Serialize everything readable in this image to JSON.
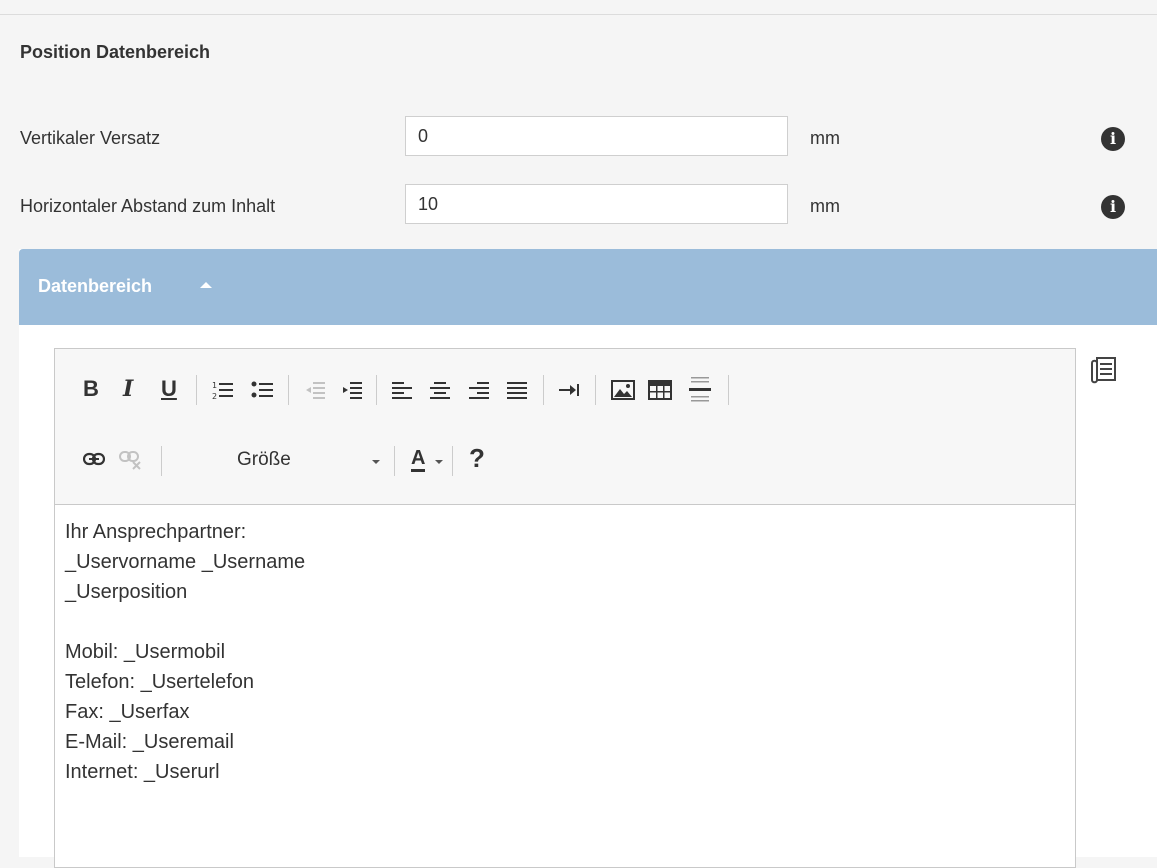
{
  "section": {
    "title": "Position Datenbereich"
  },
  "fields": [
    {
      "label": "Vertikaler Versatz",
      "value": "0",
      "unit": "mm",
      "info_icon": "info-circle"
    },
    {
      "label": "Horizontaler Abstand zum Inhalt",
      "value": "10",
      "unit": "mm",
      "info_icon": "info-circle"
    }
  ],
  "info_glyph": "i",
  "panel": {
    "title": "Datenbereich",
    "collapse_icon": "caret-up",
    "header_color": "#9bbcda"
  },
  "toolbar": {
    "bold": "B",
    "italic": "I",
    "underline": "U",
    "ordered_list_icon": "ordered-list",
    "unordered_list_icon": "unordered-list",
    "outdent_icon": "outdent",
    "indent_icon": "indent",
    "align_left_icon": "align-left",
    "align_center_icon": "align-center",
    "align_right_icon": "align-right",
    "justify_icon": "justify",
    "tab_icon": "tab-arrow",
    "image_icon": "image",
    "table_icon": "table",
    "hr_icon": "horizontal-rule",
    "link_icon": "link",
    "unlink_icon": "unlink",
    "size_label": "Größe",
    "font_color_label": "A",
    "help_label": "?"
  },
  "editor_content": [
    "Ihr Ansprechpartner:",
    "_Uservorname _Username",
    "_Userposition",
    "",
    "Mobil: _Usermobil",
    "Telefon: _Usertelefon",
    "Fax: _Userfax",
    "E-Mail: _Useremail",
    "Internet: _Userurl"
  ],
  "side_icon": "template-list"
}
